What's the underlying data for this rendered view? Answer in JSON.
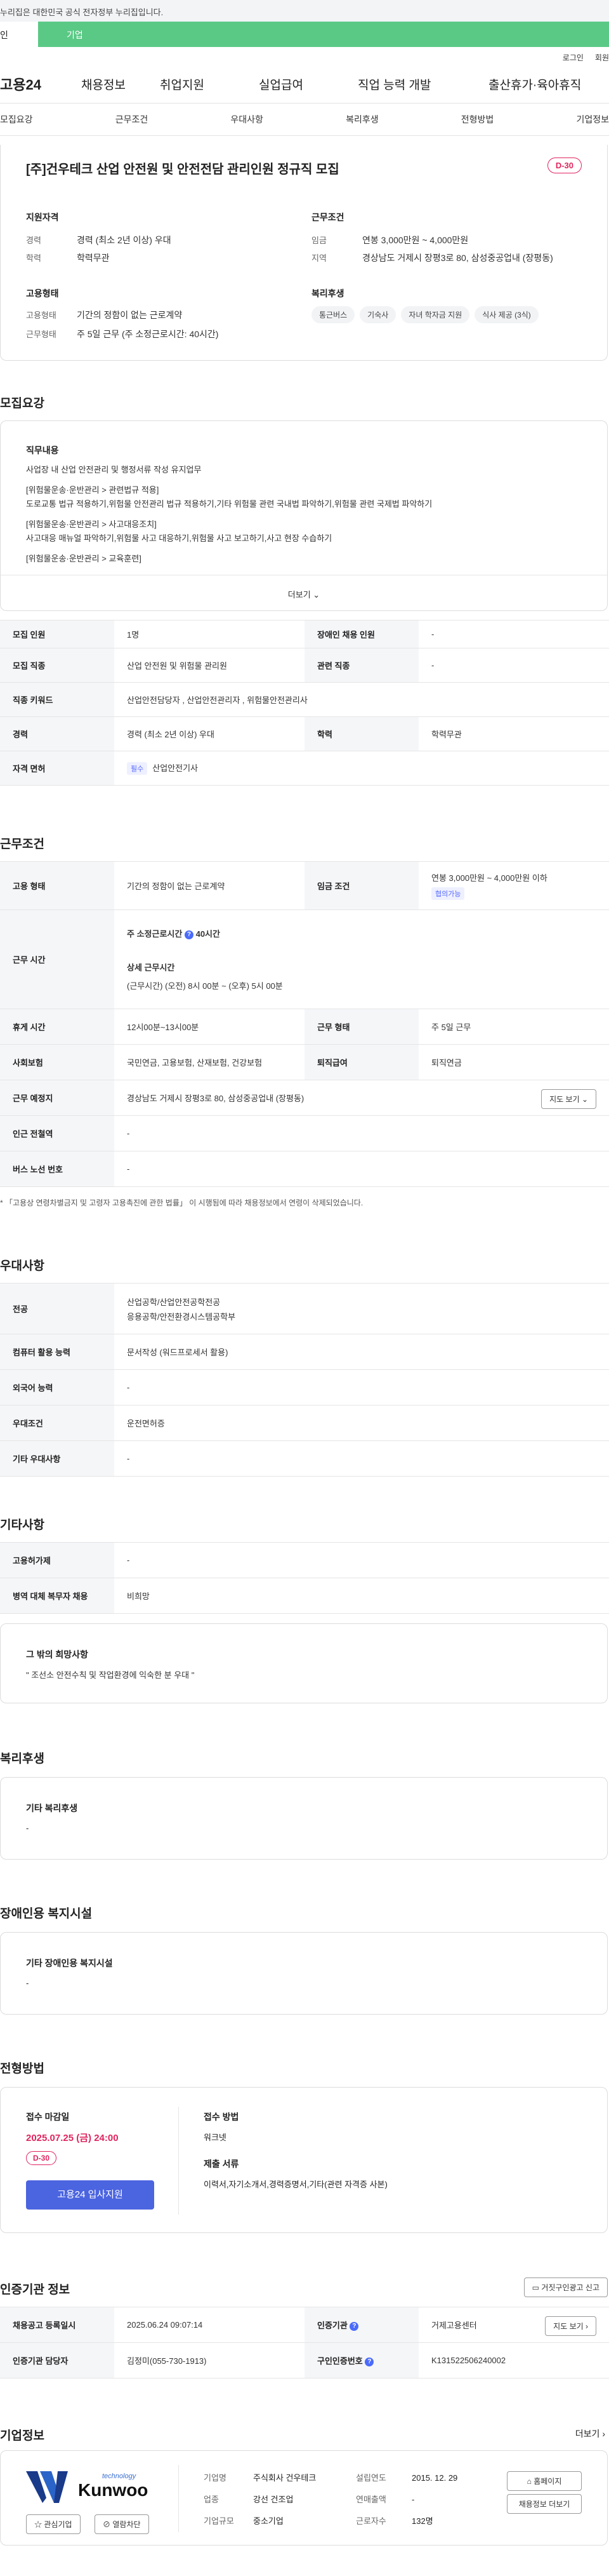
{
  "gov_banner": "누리집은 대한민국 공식 전자정부 누리집입니다.",
  "tabs": {
    "left": "인",
    "right": "기업"
  },
  "util": {
    "login": "로그인",
    "join": "회원"
  },
  "gnb": {
    "logo": "고용24",
    "items": [
      "채용정보",
      "취업지원",
      "실업급여",
      "직업 능력 개발",
      "출산휴가·육아휴직"
    ]
  },
  "subnav": [
    "모집요강",
    "근무조건",
    "우대사항",
    "복리후생",
    "전형방법",
    "기업정보"
  ],
  "job": {
    "title": "[주]건우테크 산업 안전원 및 안전전담 관리인원 정규직 모집",
    "dday": "D-30",
    "qual_title": "지원자격",
    "qual": [
      {
        "k": "경력",
        "v": "경력 (최소 2년 이상) 우대"
      },
      {
        "k": "학력",
        "v": "학력무관"
      }
    ],
    "cond_title": "근무조건",
    "cond": [
      {
        "k": "임금",
        "v": "연봉 3,000만원 ~ 4,000만원"
      },
      {
        "k": "지역",
        "v": "경상남도 거제시 장평3로 80, 삼성중공업내 (장평동)"
      }
    ],
    "emp_title": "고용형태",
    "emp": [
      {
        "k": "고용형태",
        "v": "기간의 정함이 없는 근로계약"
      },
      {
        "k": "근무형태",
        "v": "주 5일 근무 (주 소정근로시간: 40시간)"
      }
    ],
    "welfare_title": "복리후생",
    "welfare": [
      "통근버스",
      "기숙사",
      "자녀 학자금 지원",
      "식사 제공 (3식)"
    ]
  },
  "recruit": {
    "title": "모집요강",
    "desc_title": "직무내용",
    "desc_lines": [
      "사업장 내 산업 안전관리 및 행정서류 작성 유지업무",
      "",
      "[위험물운송·운반관리 > 관련법규 적용]",
      "도로교통 법규 적용하기,위험물 안전관리 법규 적용하기,기타 위험물 관련 국내법 파악하기,위험물 관련 국제법 파악하기",
      "",
      "[위험물운송·운반관리 > 사고대응조치]",
      "사고대응 매뉴얼 파악하기,위험물 사고 대응하기,위험물 사고 보고하기,사고 현장 수습하기",
      "",
      "[위험물운송·운반관리 > 교육훈련]"
    ],
    "more": "더보기"
  },
  "recruit_table": {
    "r1": {
      "k1": "모집 인원",
      "v1": "1명",
      "k2": "장애인 채용 인원",
      "v2": "-"
    },
    "r2": {
      "k1": "모집 직종",
      "v1": "산업 안전원 및 위험물 관리원",
      "k2": "관련 직종",
      "v2": "-"
    },
    "r3": {
      "k1": "직종 키워드",
      "v1": "산업안전담당자 , 산업안전관리자 , 위험물안전관리사"
    },
    "r4": {
      "k1": "경력",
      "v1": "경력 (최소 2년 이상) 우대",
      "k2": "학력",
      "v2": "학력무관"
    },
    "r5": {
      "k1": "자격 면허",
      "tag": "필수",
      "v1": "산업안전기사"
    }
  },
  "work": {
    "title": "근무조건",
    "emp_k": "고용 형태",
    "emp_v": "기간의 정함이 없는 근로계약",
    "wage_k": "임금 조건",
    "wage_v": "연봉 3,000만원 ~ 4,000만원 이하",
    "wage_tag": "협의가능",
    "hours_k": "근무 시간",
    "hours_main": "주 소정근로시간",
    "hours_main_v": "40시간",
    "hours_detail_title": "상세 근무시간",
    "hours_detail": "(근무시간) (오전) 8시 00분 ~ (오후) 5시 00분",
    "break_k": "휴게 시간",
    "break_v": "12시00분~13시00분",
    "form_k": "근무 형태",
    "form_v": "주 5일 근무",
    "ins_k": "사회보험",
    "ins_v": "국민연금, 고용보험, 산재보험, 건강보험",
    "retire_k": "퇴직급여",
    "retire_v": "퇴직연금",
    "place_k": "근무 예정지",
    "place_v": "경상남도 거제시 장평3로 80, 삼성중공업내 (장평동)",
    "map_btn": "지도 보기",
    "subway_k": "인근 전철역",
    "subway_v": "-",
    "bus_k": "버스 노선 번호",
    "bus_v": "-",
    "note": "* 「고용상 연령차별금지 및 고령자 고용촉진에 관한 법률」 이 시행됨에 따라 채용정보에서 연령이 삭제되었습니다."
  },
  "pref": {
    "title": "우대사항",
    "major_k": "전공",
    "major_v1": "산업공학/산업안전공학전공",
    "major_v2": "응용공학/안전환경시스템공학부",
    "pc_k": "컴퓨터 활용 능력",
    "pc_v": "문서작성 (워드프로세서 활용)",
    "lang_k": "외국어 능력",
    "lang_v": "-",
    "cond_k": "우대조건",
    "cond_v": "운전면허증",
    "etc_k": "기타 우대사항",
    "etc_v": "-"
  },
  "other": {
    "title": "기타사항",
    "disab_k": "고용허가제",
    "disab_v": "-",
    "mil_k": "병역 대체 복무자 채용",
    "mil_v": "비희망",
    "req_title": "그 밖의 희망사항",
    "req_v": "\" 조선소 안전수칙 및 작업환경에 익숙한 분 우대 \""
  },
  "welfare": {
    "title": "복리후생",
    "box_title": "기타 복리후생",
    "box_v": "-"
  },
  "disabled": {
    "title": "장애인용 복지시설",
    "box_title": "기타 장애인용 복지시설",
    "box_v": "-"
  },
  "process": {
    "title": "전형방법",
    "deadline_k": "접수 마감일",
    "deadline_v": "2025.07.25 (금) 24:00",
    "dday": "D-30",
    "apply": "고용24 입사지원",
    "method_k": "접수 방법",
    "method_v": "워크넷",
    "docs_k": "제출 서류",
    "docs_v": "이력서,자기소개서,경력증명서,기타(관련 자격증 사본)"
  },
  "cert": {
    "title": "인증기관 정보",
    "report_btn": "거짓구인광고 신고",
    "reg_k": "채용공고 등록일시",
    "reg_v": "2025.06.24 09:07:14",
    "org_k": "인증기관",
    "org_v": "거제고용센터",
    "map_btn": "지도 보기",
    "mgr_k": "인증기관 담당자",
    "mgr_v": "김정미(055-730-1913)",
    "no_k": "구인인증번호",
    "no_v": "K131522506240002"
  },
  "company": {
    "title": "기업정보",
    "more": "더보기",
    "logo_top": "technology",
    "logo_name": "Kunwoo",
    "fav": "관심기업",
    "block": "열람차단",
    "name_k": "기업명",
    "name_v": "주식회사 건우테크",
    "industry_k": "업종",
    "industry_v": "강선 건조업",
    "size_k": "기업규모",
    "size_v": "중소기업",
    "est_k": "설립연도",
    "est_v": "2015. 12. 29",
    "sales_k": "연매출액",
    "sales_v": "-",
    "emp_k": "근로자수",
    "emp_v": "132명",
    "home_btn": "홈페이지",
    "jobs_btn": "채용정보 더보기"
  },
  "colors": {
    "accent": "#4b64e0",
    "green": "#5bc986",
    "dday": "#e0245e"
  }
}
